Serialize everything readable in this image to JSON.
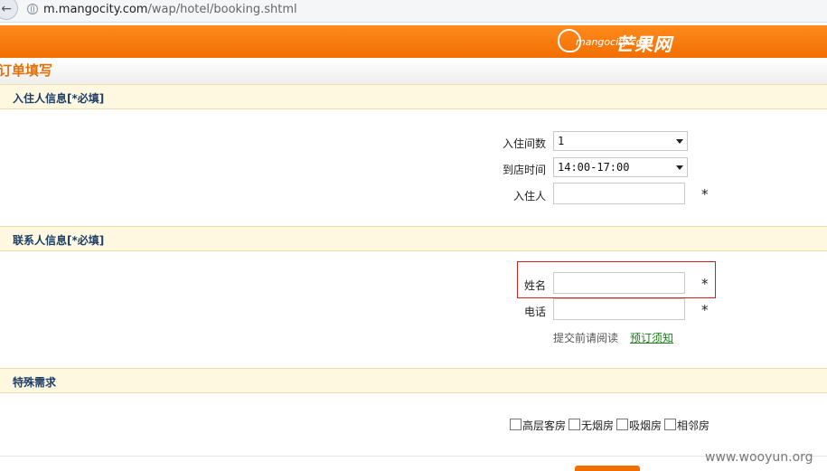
{
  "browser": {
    "url_host": "m.mangocity.com",
    "url_path": "/wap/hotel/booking.shtml"
  },
  "banner": {
    "logo_text": "mangocity.com",
    "logo_cn": "芒果网"
  },
  "page": {
    "title": "订单填写"
  },
  "sections": {
    "guest": {
      "header": "入住人信息[*必填]",
      "rooms_label": "入住间数",
      "rooms_value": "1",
      "arrival_label": "到店时间",
      "arrival_value": "14:00-17:00",
      "guest_label": "入住人",
      "guest_value": "",
      "required_mark": "*"
    },
    "contact": {
      "header": "联系人信息[*必填]",
      "name_label": "姓名",
      "name_value": "",
      "phone_label": "电话",
      "phone_value": "",
      "required_mark": "*",
      "note": "提交前请阅读",
      "link": "预订须知"
    },
    "special": {
      "header": "特殊需求",
      "options": [
        "高层客房",
        "无烟房",
        "吸烟房",
        "相邻房"
      ]
    }
  },
  "watermark": "www.wooyun.org",
  "colors": {
    "brand_orange": "#f26f00",
    "title_orange": "#e2700a",
    "header_text": "#1e3f66",
    "highlight_red": "#cc2222",
    "link_green": "#1a7d1a"
  }
}
